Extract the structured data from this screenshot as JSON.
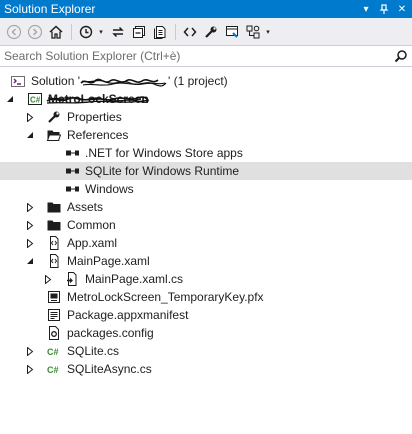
{
  "window": {
    "title": "Solution Explorer",
    "pin_glyph": "▾",
    "dock_glyph": "╀",
    "close_glyph": "✕"
  },
  "toolbar": {
    "buttons": [
      "back-icon",
      "forward-icon",
      "home-icon",
      "history-icon",
      "sync-icon",
      "collapse-all-icon",
      "show-all-files-icon",
      "view-code-icon",
      "properties-icon",
      "preview-icon",
      "class-view-icon"
    ],
    "dropdown_glyph": "▾"
  },
  "search": {
    "placeholder": "Search Solution Explorer (Ctrl+è)",
    "icon": "search-icon"
  },
  "tree": {
    "solution": {
      "prefix": "Solution '",
      "suffix": "' (1 project)"
    },
    "project": {
      "name": "MetroLockScreen"
    },
    "items": [
      {
        "label": "Properties",
        "icon": "wrench-icon"
      },
      {
        "label": "References",
        "icon": "folder-open-icon"
      },
      {
        "label": ".NET for Windows Store apps",
        "icon": "reference-icon"
      },
      {
        "label": "SQLite for Windows Runtime",
        "icon": "reference-icon"
      },
      {
        "label": "Windows",
        "icon": "reference-icon"
      },
      {
        "label": "Assets",
        "icon": "folder-icon"
      },
      {
        "label": "Common",
        "icon": "folder-icon"
      },
      {
        "label": "App.xaml",
        "icon": "xaml-icon"
      },
      {
        "label": "MainPage.xaml",
        "icon": "xaml-icon"
      },
      {
        "label": "MainPage.xaml.cs",
        "icon": "csharp-file-icon"
      },
      {
        "label": "MetroLockScreen_TemporaryKey.pfx",
        "icon": "key-file-icon"
      },
      {
        "label": "Package.appxmanifest",
        "icon": "manifest-icon"
      },
      {
        "label": "packages.config",
        "icon": "config-icon"
      },
      {
        "label": "SQLite.cs",
        "icon": "csharp-icon"
      },
      {
        "label": "SQLiteAsync.cs",
        "icon": "csharp-icon"
      }
    ]
  },
  "colors": {
    "accent": "#007acc",
    "toolbar_bg": "#eeeef2",
    "selected_row": "#e0e0e0",
    "csharp_green": "#388a34"
  }
}
